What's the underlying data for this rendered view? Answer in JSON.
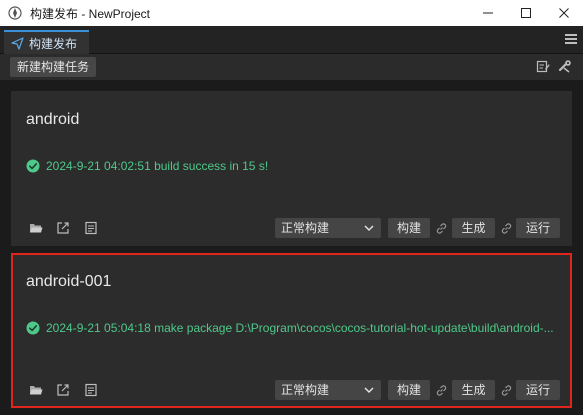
{
  "window": {
    "title": "构建发布 - NewProject"
  },
  "panel": {
    "tab_label": "构建发布"
  },
  "toolbar": {
    "new_task_label": "新建构建任务"
  },
  "tasks": [
    {
      "name": "android",
      "status": "2024-9-21 04:02:51 build success in 15 s!",
      "build_mode": "正常构建",
      "build_label": "构建",
      "make_label": "生成",
      "run_label": "运行",
      "selected": false
    },
    {
      "name": "android-001",
      "status": "2024-9-21 05:04:18 make package D:\\Program\\cocos\\cocos-tutorial-hot-update\\build\\android-...",
      "build_mode": "正常构建",
      "build_label": "构建",
      "make_label": "生成",
      "run_label": "运行",
      "selected": true
    }
  ],
  "colors": {
    "accent": "#3a8fd6",
    "success": "#4fc98a",
    "selection": "#e0261c"
  }
}
